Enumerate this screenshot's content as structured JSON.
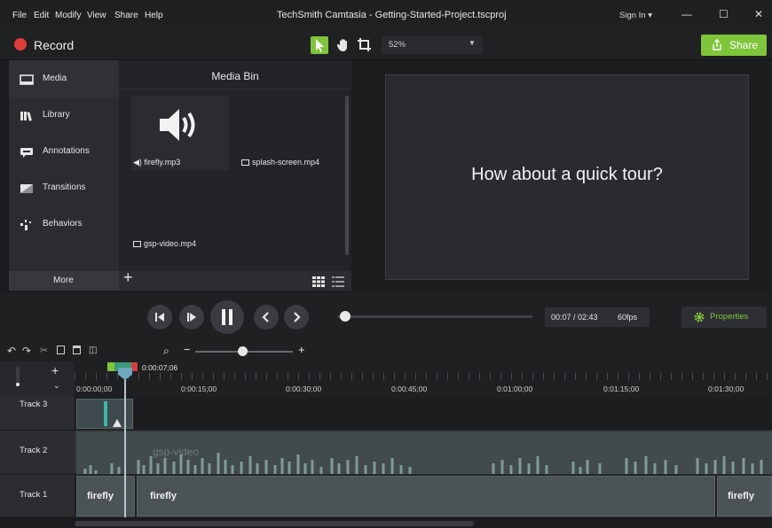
{
  "menu": [
    "File",
    "Edit",
    "Modify",
    "View",
    "Share",
    "Help"
  ],
  "app_title": "TechSmith Camtasia - Getting-Started-Project.tscproj",
  "sign_in": "Sign In ▾",
  "window_controls": {
    "minimize": "—",
    "maximize": "☐",
    "close": "✕"
  },
  "toolbar": {
    "record_label": "Record",
    "zoom_value": "52%",
    "share_label": "Share"
  },
  "nav": {
    "items": [
      {
        "label": "Media",
        "icon": "media-icon"
      },
      {
        "label": "Library",
        "icon": "library-icon"
      },
      {
        "label": "Annotations",
        "icon": "annotations-icon"
      },
      {
        "label": "Transitions",
        "icon": "transitions-icon"
      },
      {
        "label": "Behaviors",
        "icon": "behaviors-icon"
      }
    ],
    "more_label": "More"
  },
  "media_bin": {
    "title": "Media Bin",
    "items": [
      {
        "label": "◀) firefly.mp3",
        "type": "audio"
      },
      {
        "label": "splash-screen.mp4",
        "type": "video"
      },
      {
        "label": "gsp-video.mp4",
        "type": "video"
      }
    ]
  },
  "canvas": {
    "text": "How about a quick tour?"
  },
  "playback": {
    "time": "00:07 / 02:43",
    "fps": "60fps",
    "properties_label": "Properties",
    "progress": 0.04
  },
  "timeline": {
    "playhead_time": "0:00:07;06",
    "ticks": [
      "0:00:00;00",
      "0:00:15;00",
      "0:00:30;00",
      "0:00:45;00",
      "0:01:00;00",
      "0:01:15;00",
      "0:01:30;00"
    ],
    "tracks": [
      {
        "label": "Track 3"
      },
      {
        "label": "Track 2",
        "clip": "gsp-video"
      },
      {
        "label": "Track 1",
        "clips": [
          "firefly",
          "firefly",
          "firefly"
        ]
      }
    ]
  },
  "colors": {
    "accent": "#7fc53a",
    "record": "#e23b3b",
    "playhead": "#6fa7bf"
  }
}
